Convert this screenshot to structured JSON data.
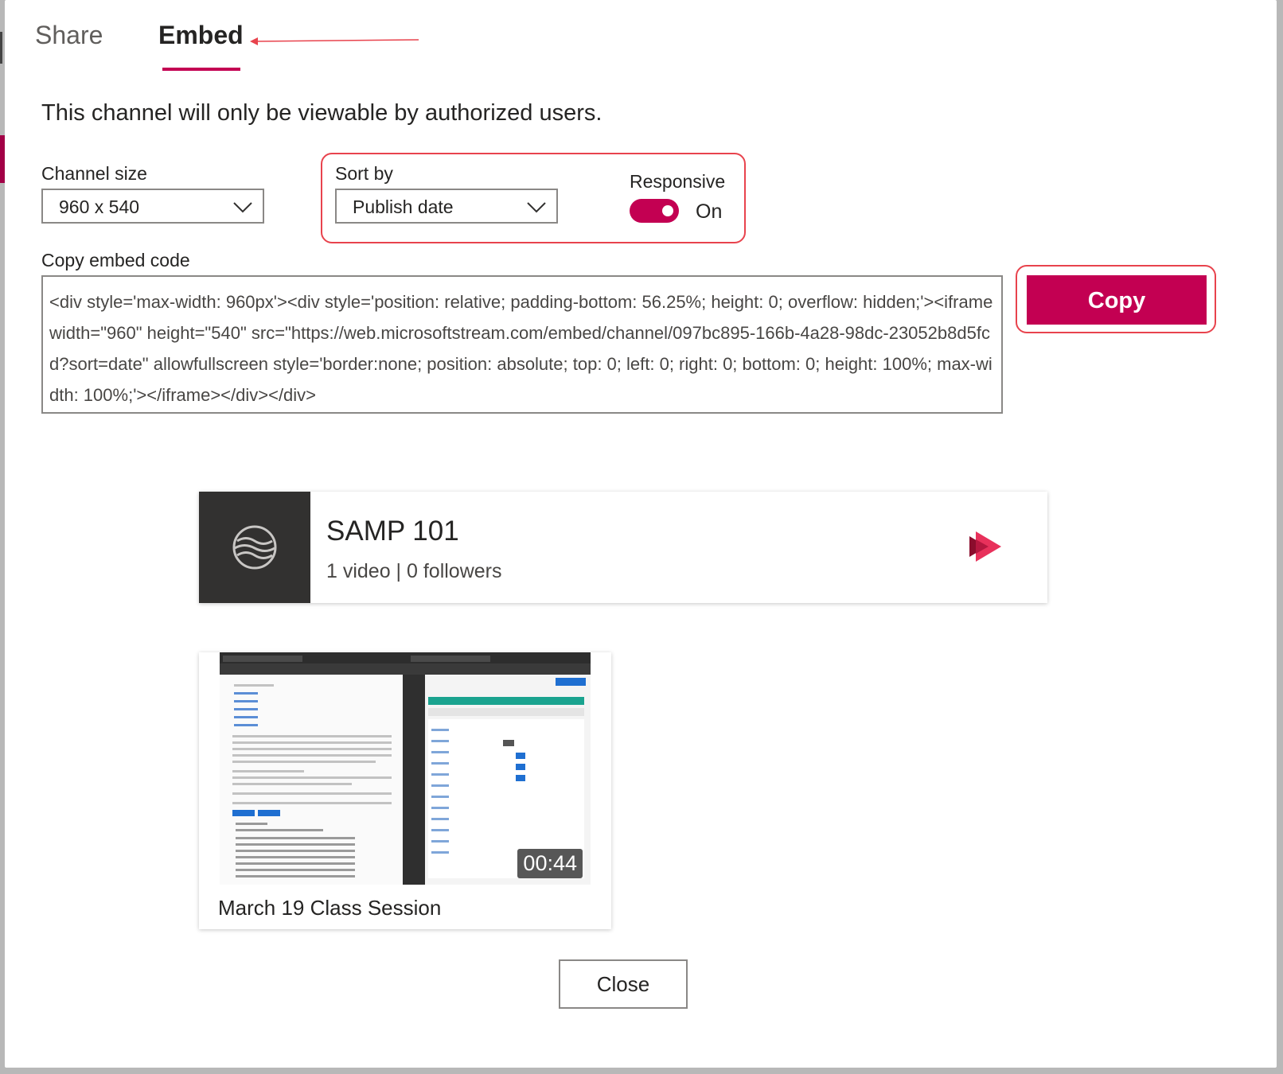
{
  "tabs": [
    {
      "label": "Share",
      "active": false
    },
    {
      "label": "Embed",
      "active": true
    }
  ],
  "notice": "This channel will only be viewable by authorized users.",
  "channel_size": {
    "label": "Channel size",
    "value": "960 x 540"
  },
  "sort_by": {
    "label": "Sort by",
    "value": "Publish date"
  },
  "responsive": {
    "label": "Responsive",
    "state": "On",
    "enabled": true
  },
  "embed": {
    "label": "Copy embed code",
    "code": "<div style='max-width: 960px'><div style='position: relative; padding-bottom: 56.25%; height: 0; overflow: hidden;'><iframe width=\"960\" height=\"540\" src=\"https://web.microsoftstream.com/embed/channel/097bc895-166b-4a28-98dc-23052b8d5fcd?sort=date\" allowfullscreen style='border:none; position: absolute; top: 0; left: 0; right: 0; bottom: 0; height: 100%; max-width: 100%;'></iframe></div></div>",
    "copy_label": "Copy"
  },
  "channel": {
    "name": "SAMP 101",
    "meta": "1 video | 0 followers"
  },
  "video": {
    "title": "March 19 Class Session",
    "duration": "00:44"
  },
  "close_label": "Close",
  "colors": {
    "accent": "#c30052",
    "annotation": "#e8434d"
  }
}
